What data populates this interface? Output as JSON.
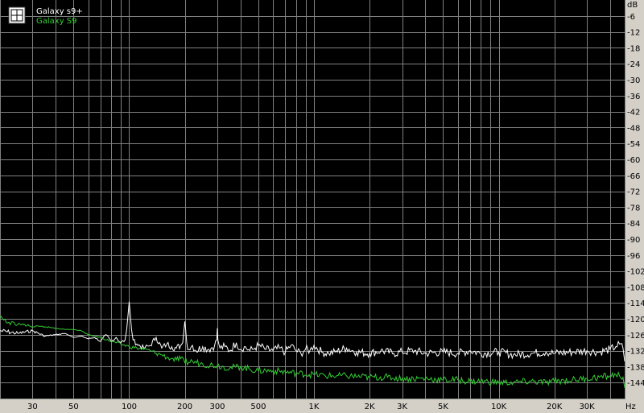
{
  "chart_data": {
    "type": "line",
    "title": "",
    "xlabel": "Hz",
    "ylabel": "dB",
    "x_scale": "log",
    "xlim": [
      20,
      48000
    ],
    "ylim": [
      -150,
      0
    ],
    "grid": true,
    "legend_position": "top-left",
    "x_ticks": [
      30,
      50,
      100,
      200,
      300,
      500,
      1000,
      2000,
      3000,
      5000,
      10000,
      20000,
      30000
    ],
    "x_tick_labels": [
      "30",
      "50",
      "100",
      "200",
      "300",
      "500",
      "1K",
      "2K",
      "3K",
      "5K",
      "10K",
      "20K",
      "30K"
    ],
    "y_ticks": [
      -6,
      -12,
      -18,
      -24,
      -30,
      -36,
      -42,
      -48,
      -54,
      -60,
      -66,
      -72,
      -78,
      -84,
      -90,
      -96,
      -102,
      -108,
      -114,
      -120,
      -126,
      -132,
      -138,
      -144
    ],
    "y_tick_labels": [
      "-6",
      "-12",
      "-18",
      "-24",
      "-30",
      "-36",
      "-42",
      "-48",
      "-54",
      "-60",
      "-66",
      "-72",
      "-78",
      "-84",
      "-90",
      "-96",
      "-102",
      "-108",
      "-114",
      "-120",
      "-126",
      "-132",
      "-138",
      "-144"
    ],
    "series": [
      {
        "name": "Galaxy s9+",
        "color": "#ffffff",
        "x": [
          20,
          25,
          30,
          35,
          40,
          45,
          50,
          55,
          60,
          65,
          70,
          75,
          80,
          85,
          90,
          95,
          97,
          99,
          100,
          101,
          103,
          105,
          110,
          120,
          130,
          140,
          150,
          160,
          170,
          180,
          190,
          195,
          198,
          200,
          202,
          205,
          210,
          220,
          230,
          250,
          270,
          290,
          298,
          300,
          302,
          310,
          330,
          350,
          380,
          400,
          420,
          450,
          480,
          500,
          550,
          600,
          650,
          700,
          750,
          800,
          850,
          900,
          950,
          1000,
          1100,
          1200,
          1300,
          1500,
          1700,
          2000,
          2300,
          2700,
          3000,
          3500,
          4000,
          5000,
          6000,
          7000,
          8000,
          10000,
          12000,
          15000,
          18000,
          20000,
          25000,
          30000,
          35000,
          40000,
          43000,
          45000,
          47000,
          48000
        ],
        "values": [
          -124.5,
          -125.5,
          -124.5,
          -126.5,
          -126,
          -125.5,
          -127,
          -126.5,
          -127.5,
          -127,
          -128.5,
          -126,
          -128.5,
          -127,
          -129,
          -128,
          -124,
          -117,
          -113.5,
          -117,
          -124,
          -128,
          -129.5,
          -131,
          -130,
          -127,
          -131,
          -129.5,
          -130.5,
          -131,
          -130,
          -129,
          -124,
          -121,
          -124,
          -129,
          -131.5,
          -130,
          -132,
          -130.5,
          -131.5,
          -130,
          -128,
          -123.5,
          -128,
          -131,
          -130.5,
          -132,
          -129,
          -131.5,
          -130.5,
          -132,
          -131,
          -130,
          -131.5,
          -132,
          -131,
          -132.5,
          -130,
          -132,
          -133,
          -131.5,
          -132,
          -130,
          -132.5,
          -133,
          -132.5,
          -131,
          -132.5,
          -133,
          -132,
          -133,
          -132.5,
          -132,
          -133,
          -132.5,
          -133,
          -132,
          -133,
          -132.5,
          -133.5,
          -133,
          -132.5,
          -133,
          -132.5,
          -132,
          -132.5,
          -131.5,
          -130.5,
          -129.5,
          -131,
          -136
        ]
      },
      {
        "name": "Galaxy S9",
        "color": "#33cc33",
        "x": [
          20,
          22,
          25,
          28,
          30,
          35,
          40,
          45,
          50,
          55,
          60,
          70,
          80,
          90,
          100,
          110,
          120,
          130,
          140,
          150,
          160,
          170,
          180,
          190,
          200,
          220,
          250,
          300,
          350,
          400,
          450,
          500,
          600,
          700,
          800,
          1000,
          1200,
          1500,
          2000,
          2500,
          3000,
          4000,
          5000,
          6000,
          7000,
          8000,
          10000,
          12000,
          15000,
          18000,
          20000,
          25000,
          30000,
          35000,
          40000,
          43000,
          45000,
          47000,
          48000
        ],
        "values": [
          -119.5,
          -121.5,
          -122,
          -122.5,
          -123,
          -123,
          -123.5,
          -124,
          -124,
          -124.5,
          -126,
          -127,
          -128.5,
          -129.5,
          -130.5,
          -131,
          -131.5,
          -132,
          -133,
          -133.5,
          -134.5,
          -135,
          -135.5,
          -135,
          -136.5,
          -136,
          -137,
          -137.5,
          -138.5,
          -138,
          -139,
          -139.5,
          -139.5,
          -140,
          -140.5,
          -141,
          -141.5,
          -141.5,
          -142,
          -142,
          -142.5,
          -142.5,
          -143,
          -143,
          -143.5,
          -143.5,
          -144,
          -144,
          -143.5,
          -144,
          -143.5,
          -143,
          -142.5,
          -142,
          -141.5,
          -141,
          -141.5,
          -142,
          -146
        ]
      }
    ]
  }
}
